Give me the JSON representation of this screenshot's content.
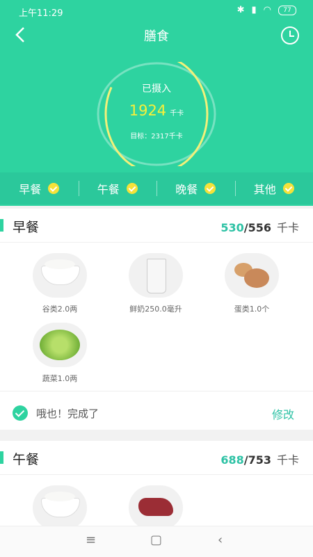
{
  "status": {
    "time": "上午11:29",
    "battery": "77"
  },
  "header": {
    "title": "膳食"
  },
  "summary": {
    "label": "已摄入",
    "value": "1924",
    "unit": "千卡",
    "goal": "目标：2317千卡",
    "progress": 0.83
  },
  "tabs": [
    {
      "label": "早餐"
    },
    {
      "label": "午餐"
    },
    {
      "label": "晚餐"
    },
    {
      "label": "其他"
    }
  ],
  "breakfast": {
    "title": "早餐",
    "eaten": "530",
    "target": "556",
    "unit": "千卡",
    "foods": [
      {
        "name": "谷类2.0两",
        "icon": "rice-bowl"
      },
      {
        "name": "鲜奶250.0毫升",
        "icon": "milk-glass"
      },
      {
        "name": "蛋类1.0个",
        "icon": "eggs"
      },
      {
        "name": "蔬菜1.0两",
        "icon": "lettuce"
      }
    ],
    "done_text": "哦也！完成了",
    "edit_label": "修改"
  },
  "lunch": {
    "title": "午餐",
    "eaten": "688",
    "target": "753",
    "unit": "千卡",
    "foods": [
      {
        "name": "",
        "icon": "rice-bowl"
      },
      {
        "name": "",
        "icon": "meat"
      }
    ]
  },
  "colors": {
    "primary": "#2ed3a0",
    "accent": "#f6f03a",
    "calorie": "#2ec2a5"
  }
}
